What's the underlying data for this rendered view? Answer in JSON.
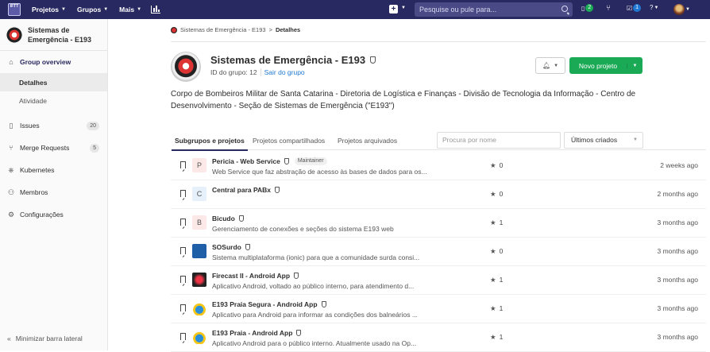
{
  "topnav": {
    "logo_text": "IFTT",
    "projects": "Projetos",
    "groups": "Grupos",
    "more": "Mais",
    "search_placeholder": "Pesquise ou pule para...",
    "mr_count": "2",
    "todo_count": "1"
  },
  "sidebar": {
    "group_name": "Sistemas de Emergência - E193",
    "overview": "Group overview",
    "details": "Detalhes",
    "activity": "Atividade",
    "issues": "Issues",
    "issues_count": "20",
    "merge_requests": "Merge Requests",
    "mr_count": "5",
    "kubernetes": "Kubernetes",
    "members": "Membros",
    "settings": "Configurações",
    "minimize": "Minimizar barra lateral"
  },
  "breadcrumb": {
    "group": "Sistemas de Emergência - E193",
    "sep": ">",
    "current": "Detalhes"
  },
  "header": {
    "title": "Sistemas de Emergência - E193",
    "group_id": "ID do grupo: 12",
    "leave": "Sair do grupo",
    "new_project": "Novo projeto"
  },
  "description": "Corpo de Bombeiros Militar de Santa Catarina - Diretoria de Logística e Finanças - Divisão de Tecnologia da Informação - Centro de Desenvolvimento - Seção de Sistemas de Emergência (\"E193\")",
  "tabs": [
    "Subgrupos e projetos",
    "Projetos compartilhados",
    "Projetos arquivados"
  ],
  "filter_placeholder": "Procura por nome",
  "sort": "Últimos criados",
  "projects": [
    {
      "letter": "P",
      "name": "Pericia - Web Service",
      "role": "Maintainer",
      "desc": "Web Service que faz abstração de acesso às bases de dados para os...",
      "stars": "0",
      "time": "2 weeks ago"
    },
    {
      "letter": "C",
      "name": "Central para PABx",
      "role": "",
      "desc": "",
      "stars": "0",
      "time": "2 months ago"
    },
    {
      "letter": "B",
      "name": "Bicudo",
      "role": "",
      "desc": "Gerenciamento de conexões e seções do sistema E193 web",
      "stars": "1",
      "time": "3 months ago"
    },
    {
      "letter": "",
      "name": "SOSurdo",
      "role": "",
      "desc": "Sistema multiplataforma (ionic) para que a comunidade surda consi...",
      "stars": "0",
      "time": "3 months ago"
    },
    {
      "letter": "",
      "name": "Firecast II - Android App",
      "role": "",
      "desc": "Aplicativo Android, voltado ao público interno, para atendimento d...",
      "stars": "1",
      "time": "3 months ago"
    },
    {
      "letter": "",
      "name": "E193 Praia Segura - Android App",
      "role": "",
      "desc": "Aplicativo para Android para informar as condições dos balneários ...",
      "stars": "1",
      "time": "3 months ago"
    },
    {
      "letter": "",
      "name": "E193 Praia - Android App",
      "role": "",
      "desc": "Aplicativo Android para o público interno. Atualmente usado na Op...",
      "stars": "1",
      "time": "3 months ago"
    }
  ]
}
